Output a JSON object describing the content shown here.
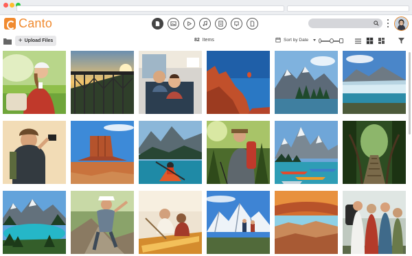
{
  "browser": {
    "url_text": "",
    "search_text": ""
  },
  "app": {
    "name": "Canto"
  },
  "nav": {
    "icons": [
      "document-icon",
      "image-icon",
      "video-icon",
      "audio-icon",
      "file-icon",
      "presentation-icon",
      "other-file-icon"
    ]
  },
  "toolbar": {
    "upload_label": "Upload Files",
    "count": "82",
    "count_label": "Items",
    "sort_label": "Sort by Date"
  },
  "gallery": {
    "items": [
      {
        "subject": "woman with coffee on grass"
      },
      {
        "subject": "steel bridge at sunset"
      },
      {
        "subject": "couple on train"
      },
      {
        "subject": "red rock cliffs with balloon"
      },
      {
        "subject": "mountain lake landscape"
      },
      {
        "subject": "glacier and lake"
      },
      {
        "subject": "hiker with camera"
      },
      {
        "subject": "desert butte"
      },
      {
        "subject": "kayak on lake"
      },
      {
        "subject": "hiker with backpack in forest"
      },
      {
        "subject": "canoes on mountain lake"
      },
      {
        "subject": "suspension bridge in jungle"
      },
      {
        "subject": "turquoise lake in mountains"
      },
      {
        "subject": "climber on rocks"
      },
      {
        "subject": "people in canoe"
      },
      {
        "subject": "snowy peaks with hikers"
      },
      {
        "subject": "rock arch canyon"
      },
      {
        "subject": "group of hikers"
      }
    ]
  }
}
